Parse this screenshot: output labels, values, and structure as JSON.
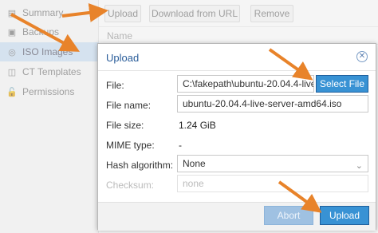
{
  "sidebar": {
    "items": [
      {
        "label": "Summary",
        "icon": "book-icon"
      },
      {
        "label": "Backups",
        "icon": "floppy-icon"
      },
      {
        "label": "ISO Images",
        "icon": "disc-icon"
      },
      {
        "label": "CT Templates",
        "icon": "file-icon"
      },
      {
        "label": "Permissions",
        "icon": "lock-icon"
      }
    ]
  },
  "toolbar": {
    "upload_label": "Upload",
    "download_label": "Download from URL",
    "remove_label": "Remove"
  },
  "grid": {
    "name_header": "Name"
  },
  "dialog": {
    "title": "Upload",
    "file_label": "File:",
    "file_value": "C:\\fakepath\\ubuntu-20.04.4-live-",
    "select_file_label": "Select File",
    "filename_label": "File name:",
    "filename_value": "ubuntu-20.04.4-live-server-amd64.iso",
    "filesize_label": "File size:",
    "filesize_value": "1.24 GiB",
    "mime_label": "MIME type:",
    "mime_value": "-",
    "hash_label": "Hash algorithm:",
    "hash_value": "None",
    "checksum_label": "Checksum:",
    "checksum_placeholder": "none",
    "abort_label": "Abort",
    "upload_label": "Upload"
  },
  "colors": {
    "accent": "#3892d4",
    "arrow": "#e8832a",
    "title": "#2a5d9a"
  }
}
